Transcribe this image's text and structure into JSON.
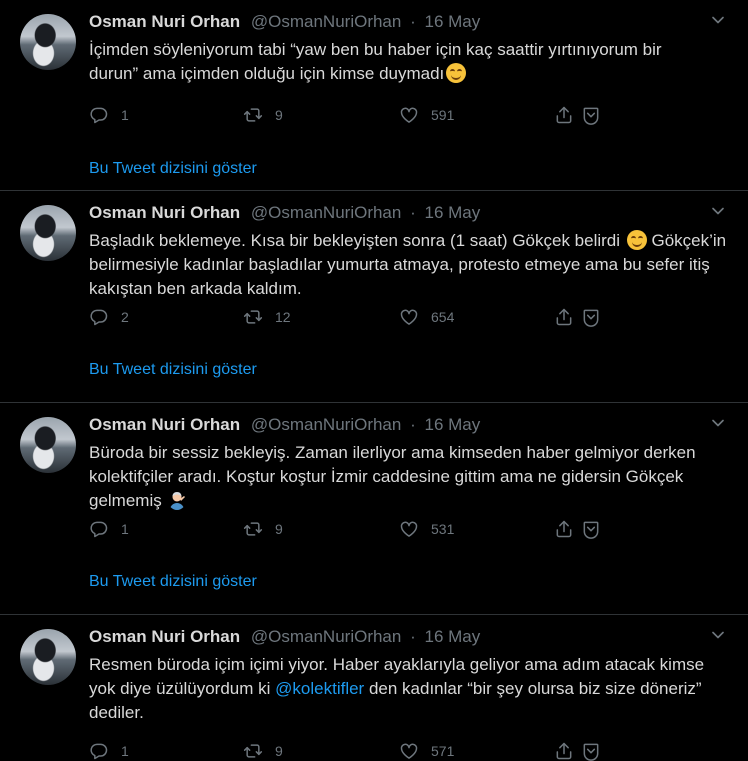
{
  "show_thread_label": "Bu Tweet dizisini göster",
  "tweets": [
    {
      "name": "Osman Nuri Orhan",
      "handle": "@OsmanNuriOrhan",
      "separator": "·",
      "date": "16 May",
      "line1": "İçimden söyleniyorum tabi “yaw ben bu haber için kaç saattir yırtınıyorum bir",
      "line2": "durun” ama içimden olduğu için kimse duymadı",
      "replies": "1",
      "retweets": "9",
      "likes": "591"
    },
    {
      "name": "Osman Nuri Orhan",
      "handle": "@OsmanNuriOrhan",
      "separator": "·",
      "date": "16 May",
      "line1a": "Başladık beklemeye. Kısa bir bekleyişten sonra (1 saat) Gökçek belirdi",
      "line1b": "Gökçek’in",
      "line2": "belirmesiyle kadınlar başladılar yumurta atmaya, protesto etmeye ama bu sefer itiş",
      "line3": "kakıştan ben arkada kaldım.",
      "replies": "2",
      "retweets": "12",
      "likes": "654"
    },
    {
      "name": "Osman Nuri Orhan",
      "handle": "@OsmanNuriOrhan",
      "separator": "·",
      "date": "16 May",
      "line1": "Büroda bir sessiz bekleyiş. Zaman ilerliyor ama kimseden haber gelmiyor derken",
      "line2": "kolektifçiler aradı. Koştur koştur İzmir caddesine gittim ama ne gidersin Gökçek",
      "line3": "gelmemiş",
      "replies": "1",
      "retweets": "9",
      "likes": "531"
    },
    {
      "name": "Osman Nuri Orhan",
      "handle": "@OsmanNuriOrhan",
      "separator": "·",
      "date": "16 May",
      "line1": "Resmen büroda içim içimi yiyor. Haber ayaklarıyla geliyor ama adım atacak kimse",
      "line2a": "yok diye üzülüyordum ki",
      "mention": "@kolektifler",
      "line2b": "den kadınlar “bir şey olursa biz size döneriz”",
      "line3": "dediler.",
      "replies": "1",
      "retweets": "9",
      "likes": "571"
    }
  ]
}
